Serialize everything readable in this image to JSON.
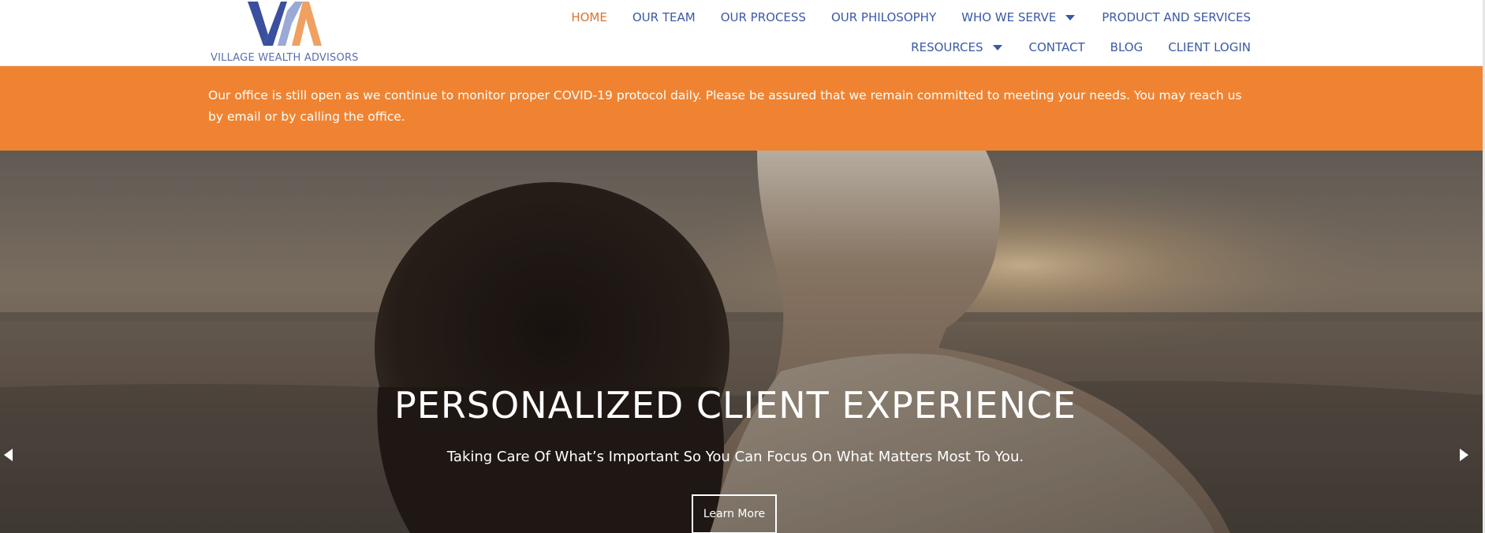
{
  "brand": {
    "name": "VILLAGE WEALTH ADVISORS",
    "logo_icon": "vwa-monogram-logo"
  },
  "nav": {
    "row1": [
      {
        "label": "HOME",
        "active": true
      },
      {
        "label": "OUR TEAM"
      },
      {
        "label": "OUR PROCESS"
      },
      {
        "label": "OUR PHILOSOPHY"
      },
      {
        "label": "WHO WE SERVE",
        "dropdown": true
      },
      {
        "label": "PRODUCT AND SERVICES"
      }
    ],
    "row2": [
      {
        "label": "RESOURCES",
        "dropdown": true
      },
      {
        "label": "CONTACT"
      },
      {
        "label": "BLOG"
      },
      {
        "label": "CLIENT LOGIN"
      }
    ]
  },
  "notice": {
    "text": "Our office is still open as we continue to monitor proper COVID-19 protocol daily. Please be assured that we remain committed to meeting your needs. You may reach us by email or by calling the office."
  },
  "hero": {
    "title": "PERSONALIZED CLIENT EXPERIENCE",
    "subtitle": "Taking Care Of What’s Important So You Can Focus On What Matters Most To You.",
    "button_label": "Learn More",
    "prev_icon": "triangle-left-icon",
    "next_icon": "triangle-right-icon"
  },
  "colors": {
    "nav_text": "#3a59a7",
    "nav_active": "#d9722e",
    "notice_bg": "#f08331",
    "logo_blue": "#3a4f9e",
    "logo_light_blue": "#9aaad6",
    "logo_orange": "#f0a060"
  }
}
